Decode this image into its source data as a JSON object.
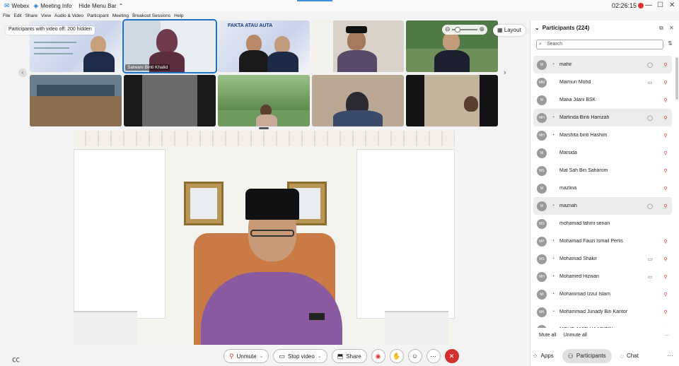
{
  "titlebar": {
    "app_name": "Webex",
    "meeting_info": "Meeting Info",
    "hide_menu": "Hide Menu Bar",
    "hide_caret": "⌃",
    "time": "02:26:15",
    "min": "—",
    "max": "☐",
    "close": "✕"
  },
  "menu": [
    "File",
    "Edit",
    "Share",
    "View",
    "Audio & Video",
    "Participant",
    "Meeting",
    "Breakout Sessions",
    "Help"
  ],
  "grid": {
    "hidden_banner": "Participants with video off: 200 hidden",
    "active_tile_name": "Salwani Binti Khalid",
    "poster_title": "FAKTA ATAU AUTA",
    "layout_label": "Layout",
    "zoom_minus": "⊖",
    "zoom_plus": "⊕",
    "prev_arrow": "‹",
    "next_arrow": "›"
  },
  "participants_panel": {
    "title": "Participants (224)",
    "collapse_icon": "⌄",
    "popout_icon": "⧉",
    "close_icon": "✕",
    "search_placeholder": "Search",
    "search_icon": "⌕",
    "sort_icon": "⇅",
    "rows": [
      {
        "initials": "M",
        "name": "mahir",
        "device": "▯",
        "video": "◔",
        "chat": "◯",
        "mic": "⚲",
        "highlight": true
      },
      {
        "initials": "MM",
        "name": "Maimun Mohd",
        "device": "",
        "video": "",
        "chat": "▭",
        "mic": "⚲",
        "highlight": false
      },
      {
        "initials": "M",
        "name": "Maria Jilani BSK",
        "device": "▯",
        "video": "",
        "chat": "",
        "mic": "⚲",
        "highlight": false
      },
      {
        "initials": "MH",
        "name": "Marlinda Binti Hamzah",
        "device": "",
        "video": "◔",
        "chat": "◯",
        "mic": "⚲",
        "highlight": true
      },
      {
        "initials": "MH",
        "name": "Marshita binti Hashim",
        "device": "",
        "video": "◔",
        "chat": "",
        "mic": "⚲",
        "highlight": false
      },
      {
        "initials": "M",
        "name": "Marsida",
        "device": "▯",
        "video": "",
        "chat": "",
        "mic": "⚲",
        "highlight": false
      },
      {
        "initials": "MS",
        "name": "Mat Sah Bin Saharom",
        "device": "▯",
        "video": "",
        "chat": "",
        "mic": "⚲",
        "highlight": false
      },
      {
        "initials": "M",
        "name": "mazlina",
        "device": "▯",
        "video": "",
        "chat": "",
        "mic": "⚲",
        "highlight": false
      },
      {
        "initials": "M",
        "name": "maznah",
        "device": "▯",
        "video": "◔",
        "chat": "◯",
        "mic": "⚲",
        "highlight": true
      },
      {
        "initials": "MS",
        "name": "mohamad fahmi senan",
        "device": "",
        "video": "",
        "chat": "",
        "mic": "",
        "highlight": false
      },
      {
        "initials": "MP",
        "name": "Mohamad Fauzi Ismail Perlis",
        "device": "",
        "video": "◔",
        "chat": "",
        "mic": "⚲",
        "highlight": false
      },
      {
        "initials": "MS",
        "name": "Mohamad Shakir",
        "device": "",
        "video": "◔",
        "chat": "▭",
        "mic": "⚲",
        "highlight": false
      },
      {
        "initials": "MH",
        "name": "Mohamed Hizwan",
        "device": "",
        "video": "◔",
        "chat": "▭",
        "mic": "⚲",
        "highlight": false
      },
      {
        "initials": "MI",
        "name": "Mohammad Izzul Islam",
        "device": "",
        "video": "◔",
        "chat": "",
        "mic": "⚲",
        "highlight": false
      },
      {
        "initials": "MK",
        "name": "Mohammad Junady Bin Kantor",
        "device": "",
        "video": "◔",
        "chat": "",
        "mic": "⚲",
        "highlight": false
      },
      {
        "initials": "MA",
        "name": "MOHD AMIR HJ ARIFIN",
        "device": "",
        "video": "◔",
        "chat": "▭",
        "mic": "⚲",
        "highlight": false
      }
    ],
    "mute_all": "Mute all",
    "unmute_all": "Unmute all",
    "more": "···"
  },
  "controls": {
    "unmute": "Unmute",
    "stop_video": "Stop video",
    "share": "Share",
    "mic_icon": "⚲",
    "video_icon": "▭",
    "share_icon": "⬒",
    "record_icon": "◉",
    "hand_icon": "✋",
    "reaction_icon": "☺",
    "more_icon": "···",
    "end_icon": "✕",
    "caret": "⌄"
  },
  "bottom_tabs": {
    "apps": "Apps",
    "participants": "Participants",
    "chat": "Chat",
    "apps_icon": "⁘",
    "participants_icon": "⚇",
    "chat_icon": "◌",
    "more": "···"
  },
  "cc_icon": "㏄"
}
